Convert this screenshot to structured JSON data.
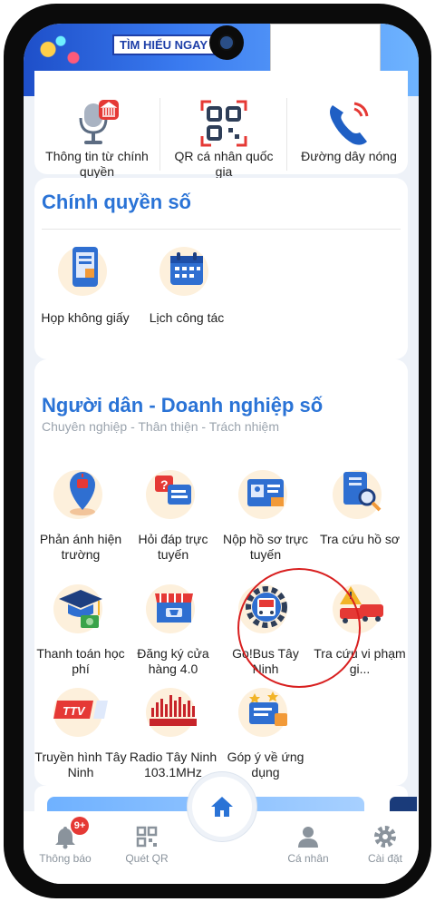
{
  "banner": {
    "button_text": "TÌM HIỂU NGAY"
  },
  "top_services": [
    {
      "label": "Thông tin từ chính quyền",
      "icon": "microphone-icon"
    },
    {
      "label": "QR cá nhân quốc gia",
      "icon": "qr-code-icon"
    },
    {
      "label": "Đường dây nóng",
      "icon": "phone-icon"
    }
  ],
  "chinh_quyen": {
    "title": "Chính quyền số",
    "items": [
      {
        "label": "Họp không giấy",
        "icon": "tablet-icon"
      },
      {
        "label": "Lịch công tác",
        "icon": "calendar-icon"
      }
    ]
  },
  "nguoi_dan": {
    "title": "Người dân - Doanh nghiệp số",
    "subtitle": "Chuyên nghiệp - Thân thiện - Trách nhiệm",
    "items": [
      {
        "label": "Phản ánh hiện trường",
        "icon": "map-pin-icon"
      },
      {
        "label": "Hỏi đáp trực tuyến",
        "icon": "chat-question-icon"
      },
      {
        "label": "Nộp hồ sơ trực tuyến",
        "icon": "id-card-icon"
      },
      {
        "label": "Tra cứu hồ sơ",
        "icon": "document-search-icon"
      },
      {
        "label": "Thanh toán học phí",
        "icon": "graduation-cap-icon"
      },
      {
        "label": "Đăng ký cửa hàng 4.0",
        "icon": "shop-icon"
      },
      {
        "label": "Go!Bus Tây Ninh",
        "icon": "bus-gear-icon"
      },
      {
        "label": "Tra cứu vi phạm gi...",
        "icon": "traffic-violation-icon"
      },
      {
        "label": "Truyền hình Tây Ninh",
        "icon": "tv-logo-icon"
      },
      {
        "label": "Radio Tây Ninh 103.1MHz",
        "icon": "radio-logo-icon"
      },
      {
        "label": "Góp ý về ứng dụng",
        "icon": "feedback-icon"
      }
    ]
  },
  "nav": {
    "notify_label": "Thông báo",
    "notify_badge": "9+",
    "scan_label": "Quét QR",
    "profile_label": "Cá nhân",
    "settings_label": "Cài đặt"
  },
  "colors": {
    "accent": "#2a73d6",
    "highlight_circle": "#d81f1f",
    "badge": "#e53935"
  }
}
